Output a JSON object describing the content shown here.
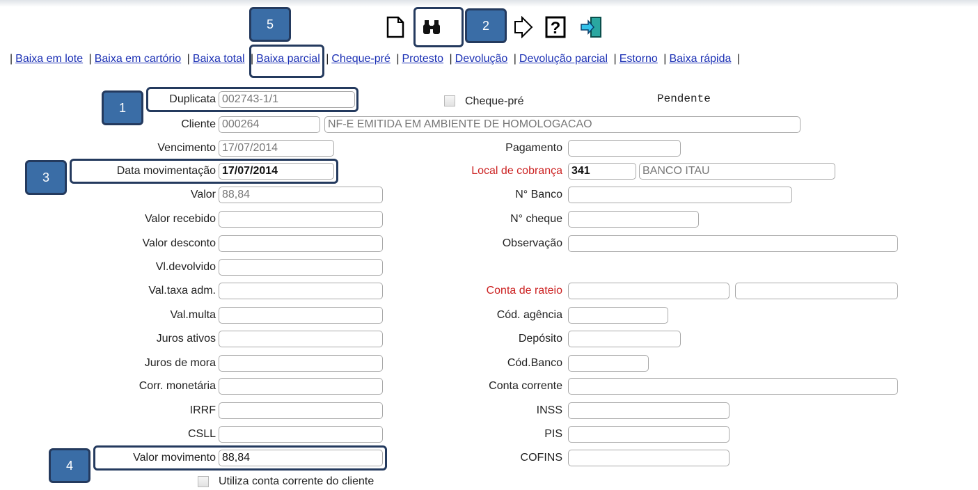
{
  "toolbar": {
    "icons": [
      "new-document-icon",
      "search-binoculars-icon",
      "next-arrow-icon",
      "help-icon",
      "exit-door-icon"
    ]
  },
  "nav": {
    "links": [
      "Baixa em lote",
      "Baixa em cartório",
      "Baixa total",
      "Baixa parcial",
      "Cheque-pré",
      "Protesto",
      "Devolução",
      "Devolução parcial",
      "Estorno",
      "Baixa rápida"
    ]
  },
  "callouts": [
    "1",
    "2",
    "3",
    "4",
    "5"
  ],
  "form": {
    "duplicata": {
      "label": "Duplicata",
      "value": "002743-1/1"
    },
    "cheque_pre": {
      "label": "Cheque-pré",
      "checked": false
    },
    "status": "Pendente",
    "cliente": {
      "label": "Cliente",
      "code": "000264",
      "name": "NF-E EMITIDA EM AMBIENTE DE HOMOLOGACAO"
    },
    "vencimento": {
      "label": "Vencimento",
      "value": "17/07/2014"
    },
    "pagamento": {
      "label": "Pagamento",
      "value": ""
    },
    "data_movimentacao": {
      "label": "Data movimentação",
      "value": "17/07/2014"
    },
    "local_cobranca": {
      "label": "Local de cobrança",
      "code": "341",
      "name": "BANCO ITAU"
    },
    "valor": {
      "label": "Valor",
      "value": "88,84"
    },
    "n_banco": {
      "label": "N° Banco",
      "value": ""
    },
    "valor_recebido": {
      "label": "Valor recebido",
      "value": ""
    },
    "n_cheque": {
      "label": "N° cheque",
      "value": ""
    },
    "valor_desconto": {
      "label": "Valor desconto",
      "value": ""
    },
    "observacao": {
      "label": "Observação",
      "value": ""
    },
    "vl_devolvido": {
      "label": "Vl.devolvido",
      "value": ""
    },
    "val_taxa_adm": {
      "label": "Val.taxa adm.",
      "value": ""
    },
    "conta_rateio": {
      "label": "Conta de rateio",
      "value1": "",
      "value2": ""
    },
    "val_multa": {
      "label": "Val.multa",
      "value": ""
    },
    "cod_agencia": {
      "label": "Cód. agência",
      "value": ""
    },
    "juros_ativos": {
      "label": "Juros ativos",
      "value": ""
    },
    "deposito": {
      "label": "Depósito",
      "value": ""
    },
    "juros_mora": {
      "label": "Juros de mora",
      "value": ""
    },
    "cod_banco": {
      "label": "Cód.Banco",
      "value": ""
    },
    "corr_monetaria": {
      "label": "Corr. monetária",
      "value": ""
    },
    "conta_corrente": {
      "label": "Conta corrente",
      "value": ""
    },
    "irrf": {
      "label": "IRRF",
      "value": ""
    },
    "inss": {
      "label": "INSS",
      "value": ""
    },
    "csll": {
      "label": "CSLL",
      "value": ""
    },
    "pis": {
      "label": "PIS",
      "value": ""
    },
    "valor_movimento": {
      "label": "Valor movimento",
      "value": "88,84"
    },
    "cofins": {
      "label": "COFINS",
      "value": ""
    },
    "utiliza_cc": {
      "label": "Utiliza conta corrente do cliente",
      "checked": false
    }
  },
  "colors": {
    "link": "#1a2fb4",
    "required_label": "#cc2222",
    "callout_fill": "#3a6da6",
    "callout_border": "#243a5e"
  }
}
